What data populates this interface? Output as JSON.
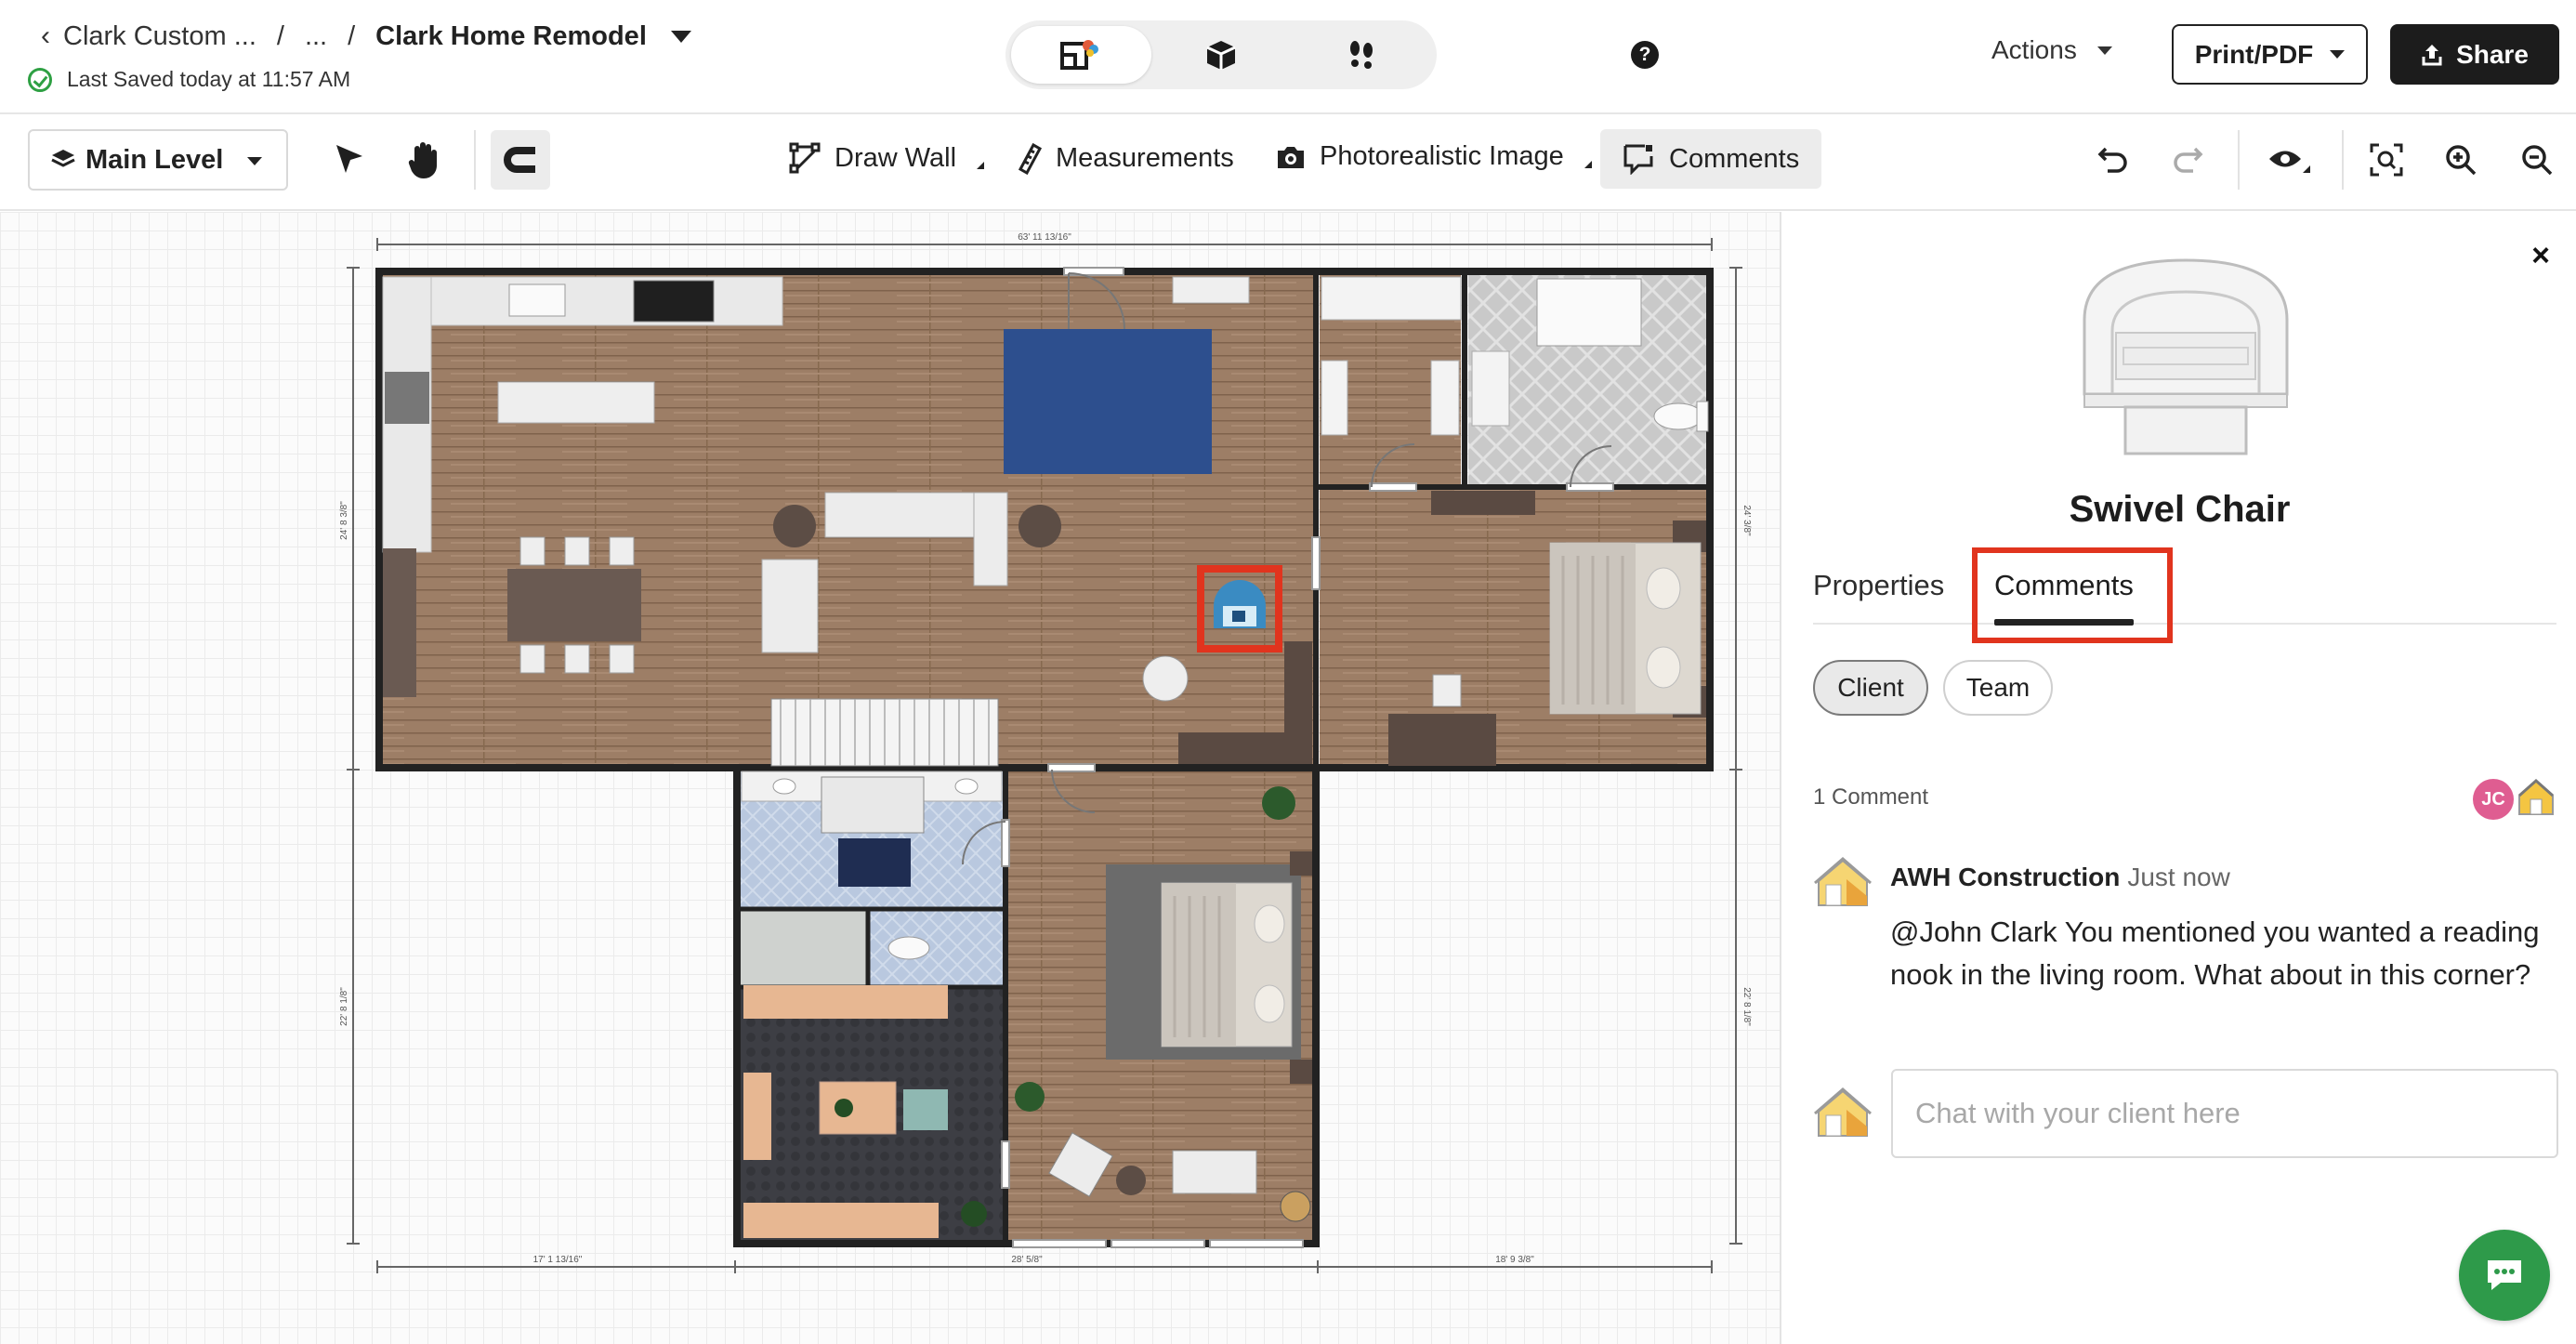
{
  "header": {
    "breadcrumb_root": "Clark Custom ...",
    "breadcrumb_ellipsis": "...",
    "separator": "/",
    "project_title": "Clark Home Remodel",
    "saved_status": "Last Saved today at 11:57 AM",
    "actions_label": "Actions",
    "print_label": "Print/PDF",
    "share_label": "Share",
    "help_glyph": "?",
    "view_modes": [
      "2d-floorplan-icon",
      "3d-box-icon",
      "walkthrough-footsteps-icon"
    ]
  },
  "toolbar": {
    "level_label": "Main Level",
    "draw_wall_label": "Draw Wall",
    "measurements_label": "Measurements",
    "photoreal_label": "Photorealistic Image",
    "comments_label": "Comments"
  },
  "canvas": {
    "dim_top": "63' 11 13/16\"",
    "dim_left_upper": "24' 8 3/8\"",
    "dim_left_lower": "22' 8 1/8\"",
    "dim_right_upper": "24' 3/8\"",
    "dim_right_lower": "22' 8 1/8\"",
    "dim_bottom_left": "17' 1 13/16\"",
    "dim_bottom_mid": "28' 5/8\"",
    "dim_bottom_right": "18' 9 3/8\""
  },
  "panel": {
    "close_glyph": "×",
    "item_name": "Swivel Chair",
    "tabs": [
      "Properties",
      "Comments"
    ],
    "active_tab": "Comments",
    "audience": [
      "Client",
      "Team"
    ],
    "comment_count": "1 Comment",
    "participant_initials": "JC",
    "comment": {
      "author": "AWH Construction",
      "time": "Just now",
      "text": "@John Clark You mentioned you wanted a reading nook in the living room. What about in this corner?"
    },
    "chat_placeholder": "Chat with your client here"
  },
  "colors": {
    "highlight_red": "#e1341e",
    "rug_blue": "#2d4f8e",
    "wall": "#222222",
    "floor_wood": "#9a7b63",
    "fab_green": "#2e9a4a",
    "avatar_pink": "#df5d91"
  }
}
